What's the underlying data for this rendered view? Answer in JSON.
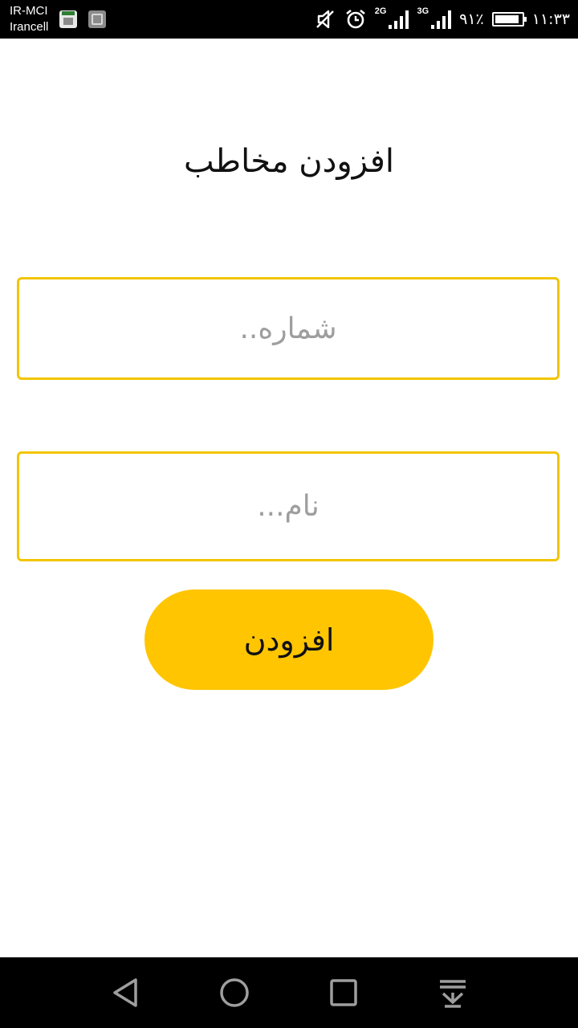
{
  "status_bar": {
    "carrier_1": "IR-MCI",
    "carrier_2": "Irancell",
    "network_1": "2G",
    "network_2": "3G",
    "battery_percent": "۹۱٪",
    "battery_level": 0.91,
    "time": "۱۱:۳۳",
    "icons": [
      "app-notification-icon",
      "image-notification-icon",
      "vibrate-off-icon",
      "alarm-icon",
      "signal-icon",
      "battery-icon"
    ]
  },
  "page": {
    "title": "افزودن مخاطب"
  },
  "form": {
    "number_placeholder": "شماره..",
    "number_value": "",
    "name_placeholder": "نام...",
    "name_value": "",
    "submit_label": "افزودن"
  },
  "nav_bar": {
    "icons": [
      "back-icon",
      "home-icon",
      "recent-apps-icon",
      "notification-pull-icon"
    ]
  },
  "colors": {
    "accent": "#ffc500",
    "field_border": "#f2c500",
    "status_bar": "#000000",
    "nav_bar": "#000000"
  }
}
